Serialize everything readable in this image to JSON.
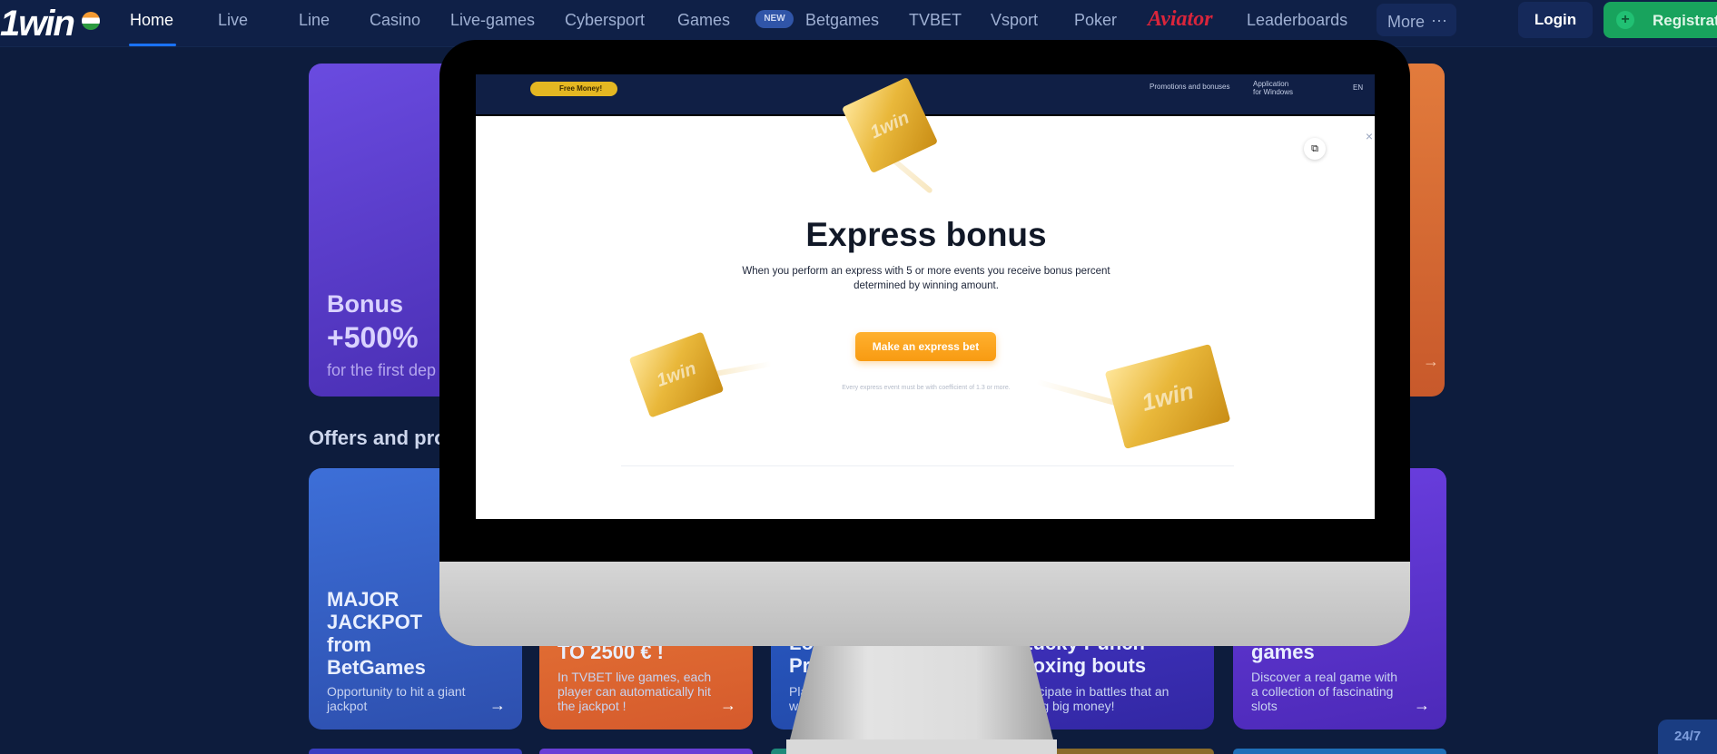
{
  "nav": {
    "logo": "1win",
    "items": [
      "Home",
      "Live",
      "Line",
      "Casino",
      "Live-games",
      "Cybersport",
      "Games"
    ],
    "new_badge": "NEW",
    "items2": [
      "Betgames",
      "TVBET",
      "Vsport",
      "Poker"
    ],
    "aviator": "Aviator",
    "leaderboards": "Leaderboards",
    "more": "More",
    "more_dots": "···",
    "login": "Login",
    "register": "Registration",
    "active_color": "#1a72f5"
  },
  "banner": {
    "title": "Bonus",
    "value": "+500%",
    "subtitle": "for the first dep"
  },
  "offers": {
    "section_title": "Offers and pro",
    "cards": [
      {
        "title": "MAJOR JACKPOT from BetGames",
        "subtitle": "Opportunity to hit a giant jackpot"
      },
      {
        "title": "TO 2500 € !",
        "subtitle": "In TVBET live games, each player can automatically hit the jackpot !"
      },
      {
        "title": "Loy Pro",
        "subtitle": "Play w warde"
      },
      {
        "title": "Lucky Punch boxing bouts",
        "subtitle": "articipate in battles that an bring big money!"
      },
      {
        "title": "games",
        "subtitle": "Discover a real game with a collection of fascinating slots"
      }
    ],
    "arrow": "→"
  },
  "chat": {
    "label": "24/7"
  },
  "monitor": {
    "inner_chip": "Free Money!",
    "inner_promo": "Promotions and bonuses",
    "inner_app_line1": "Application",
    "inner_app_line2": "for Windows",
    "inner_lang": "EN"
  },
  "modal": {
    "title": "Express bonus",
    "description": "When you perform an express with 5 or more events you receive bonus percent determined by winning amount.",
    "cta": "Make an express bet",
    "note": "Every express event must be with coefficient of 1.3 or more.",
    "close": "×",
    "ticket_text": "1win"
  }
}
